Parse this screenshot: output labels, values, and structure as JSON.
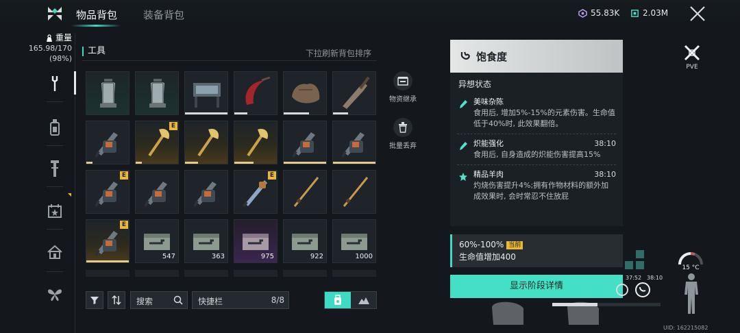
{
  "header": {
    "tabs": [
      {
        "label": "物品背包",
        "active": true
      },
      {
        "label": "装备背包",
        "active": false
      }
    ],
    "currency_1": "55.83K",
    "currency_2": "2.03M"
  },
  "weight": {
    "label": "重量",
    "value": "165.98/170",
    "percent": "(98%)"
  },
  "rail": {
    "icons": [
      "wrench-icon",
      "bottle-icon",
      "tool-icon",
      "calendar-star-icon",
      "home-icon",
      "butterfly-icon"
    ]
  },
  "section": {
    "title": "工具",
    "hint": "下拉刷新背包排序"
  },
  "slots": [
    {
      "item": "lantern",
      "rarity": "teal"
    },
    {
      "item": "lantern",
      "rarity": "teal"
    },
    {
      "item": "workbench",
      "rarity": "normal",
      "bar": "white",
      "bar_fill": 1.0
    },
    {
      "item": "sickle",
      "rarity": "normal",
      "bar": "white",
      "bar_fill": 0.3
    },
    {
      "item": "leather-bag",
      "rarity": "normal",
      "bar": "white",
      "bar_fill": 0.6
    },
    {
      "item": "knife",
      "rarity": "normal",
      "bar": "white",
      "bar_fill": 0.35
    },
    {
      "item": "chainsaw",
      "rarity": "normal",
      "bar": "gold",
      "bar_fill": 0.15
    },
    {
      "item": "axe",
      "rarity": "gold",
      "badge": "E",
      "bar": "gold",
      "bar_fill": 0.15
    },
    {
      "item": "axe",
      "rarity": "gold",
      "bar": "gold",
      "bar_fill": 0.3
    },
    {
      "item": "axe",
      "rarity": "gold",
      "bar": "gold",
      "bar_fill": 0.45
    },
    {
      "item": "chainsaw",
      "rarity": "normal",
      "bar": "gold",
      "bar_fill": 1.0
    },
    {
      "item": "chainsaw",
      "rarity": "normal",
      "bar": "gold",
      "bar_fill": 1.0
    },
    {
      "item": "chainsaw",
      "rarity": "normal",
      "badge": "E"
    },
    {
      "item": "chainsaw",
      "rarity": "normal"
    },
    {
      "item": "chainsaw",
      "rarity": "normal"
    },
    {
      "item": "chainsaw-blue",
      "rarity": "normal",
      "badge": "E"
    },
    {
      "item": "fishing-rod",
      "rarity": "normal"
    },
    {
      "item": "fishing-rod",
      "rarity": "normal"
    },
    {
      "item": "chainsaw",
      "rarity": "gold",
      "badge": "E",
      "bar": "gold",
      "bar_fill": 1.0
    },
    {
      "item": "ammo-box",
      "rarity": "normal",
      "qty": "547"
    },
    {
      "item": "ammo-box",
      "rarity": "normal",
      "qty": "363"
    },
    {
      "item": "ammo-box-purple",
      "rarity": "purple",
      "qty": "975"
    },
    {
      "item": "ammo-box",
      "rarity": "normal",
      "qty": "922"
    },
    {
      "item": "ammo-box",
      "rarity": "normal",
      "qty": "1000"
    }
  ],
  "side_actions": [
    {
      "label": "物资继承",
      "icon": "chest-icon"
    },
    {
      "label": "批量丢弃",
      "icon": "trash-icon"
    }
  ],
  "toolbar": {
    "search_label": "搜索",
    "quickbar_label": "快捷栏",
    "quickbar_value": "8/8"
  },
  "panel": {
    "title": "饱食度",
    "subtitle": "异想状态",
    "effects": [
      {
        "name": "美味杂陈",
        "time": "",
        "desc": "食用后, 增加5%-15%的元素伤害。生命值低于40%时, 此效果翻倍。",
        "icon": "syringe-icon"
      },
      {
        "name": "炽能强化",
        "time": "38:10",
        "desc": "食用后, 自身造成的炽能伤害提高15%",
        "icon": "syringe-icon"
      },
      {
        "name": "精品羊肉",
        "time": "38:10",
        "desc": "灼烧伤害提升4%;拥有作物材料的额外加成效果时, 会时常忍不住放屁",
        "icon": "star-icon"
      }
    ],
    "stage_range": "60%-100%",
    "stage_current": "当前",
    "stage_desc": "生命值增加400",
    "detail_button": "显示阶段详情"
  },
  "hud": {
    "pve": "PVE",
    "time_1": "37:52",
    "time_2": "38:10",
    "temperature": "15 °C",
    "uid": "UID: 162215082",
    "progress": 0.42
  },
  "colors": {
    "accent": "#3fd9c4",
    "gold": "#e9b935"
  }
}
